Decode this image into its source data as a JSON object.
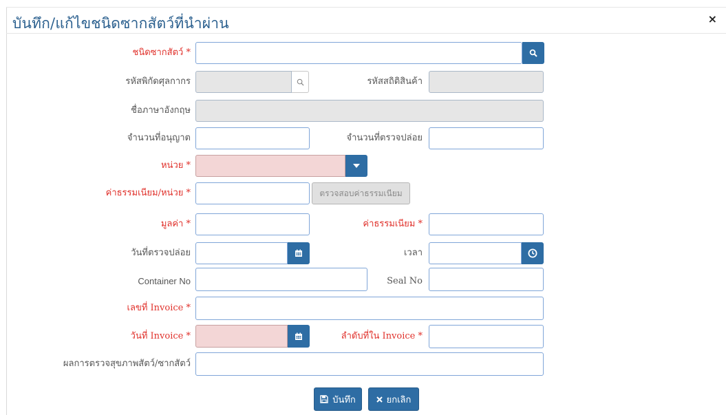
{
  "dialog": {
    "title": "บันทึก/แก้ไขชนิดซากสัตว์ที่นำผ่าน",
    "close_label": "×"
  },
  "fields": {
    "carcass_type": {
      "label": "ชนิดซากสัตว์ *",
      "value": ""
    },
    "tariff_code": {
      "label": "รหัสพิกัดศุลกากร",
      "value": ""
    },
    "stat_code": {
      "label": "รหัสสถิติสินค้า",
      "value": ""
    },
    "english_name": {
      "label": "ชื่อภาษาอังกฤษ",
      "value": ""
    },
    "permitted_qty": {
      "label": "จำนวนที่อนุญาต",
      "value": ""
    },
    "released_qty": {
      "label": "จำนวนที่ตรวจปล่อย",
      "value": ""
    },
    "unit": {
      "label": "หน่วย *",
      "value": ""
    },
    "fee_per_unit": {
      "label": "ค่าธรรมเนียม/หน่วย *",
      "value": "",
      "check_button": "ตรวจสอบค่าธรรมเนียม"
    },
    "value_amount": {
      "label": "มูลค่า *",
      "value": ""
    },
    "fee": {
      "label": "ค่าธรรมเนียม *",
      "value": ""
    },
    "release_date": {
      "label": "วันที่ตรวจปล่อย",
      "value": ""
    },
    "time": {
      "label": "เวลา",
      "value": ""
    },
    "container_no": {
      "label": "Container No",
      "value": ""
    },
    "seal_no": {
      "label": "Seal No",
      "value": ""
    },
    "invoice_no": {
      "label": "เลขที่ Invoice *",
      "value": ""
    },
    "invoice_date": {
      "label": "วันที่ Invoice *",
      "value": ""
    },
    "invoice_seq": {
      "label": "ลำดับที่ใน Invoice *",
      "value": ""
    },
    "health_result": {
      "label": "ผลการตรวจสุขภาพสัตว์/ซากสัตว์",
      "value": ""
    }
  },
  "actions": {
    "save_label": "บันทึก",
    "cancel_label": "ยกเลิก"
  },
  "icons": {
    "search": "search-icon",
    "calendar": "calendar-icon",
    "clock": "clock-icon",
    "caret": "caret-down-icon",
    "save": "floppy-disk-icon",
    "cancel": "times-icon"
  },
  "colors": {
    "accent": "#2e6da4",
    "title": "#2a5f8e",
    "required": "#e0312b",
    "input_border": "#7fa5d8",
    "readonly_bg": "#e6e6e6",
    "invalid_bg": "#f3d6d6"
  }
}
